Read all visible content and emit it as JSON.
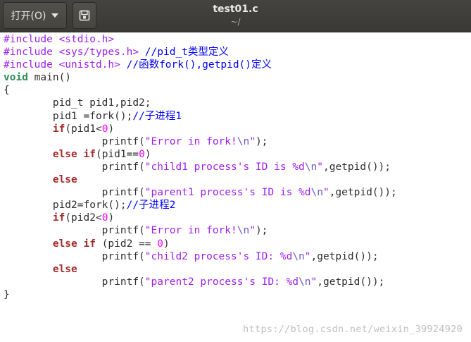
{
  "toolbar": {
    "open_label": "打开(O)",
    "title": "test01.c",
    "subtitle": "~/"
  },
  "editor": {
    "lines": [
      [
        {
          "t": "#include <stdio.h>",
          "c": "pp"
        }
      ],
      [
        {
          "t": "#include <sys/types.h>",
          "c": "pp"
        },
        {
          "t": " ",
          "c": ""
        },
        {
          "t": "//pid_t类型定义",
          "c": "cm"
        }
      ],
      [
        {
          "t": "#include <unistd.h>",
          "c": "pp"
        },
        {
          "t": " ",
          "c": ""
        },
        {
          "t": "//函数fork(),getpid()定义",
          "c": "cm"
        }
      ],
      [
        {
          "t": "void",
          "c": "ty"
        },
        {
          "t": " main()",
          "c": ""
        }
      ],
      [
        {
          "t": "{",
          "c": ""
        }
      ],
      [
        {
          "t": "        pid_t pid1,pid2;",
          "c": ""
        }
      ],
      [
        {
          "t": "        pid1 =fork();",
          "c": ""
        },
        {
          "t": "//子进程1",
          "c": "cm"
        }
      ],
      [
        {
          "t": "        ",
          "c": ""
        },
        {
          "t": "if",
          "c": "kw"
        },
        {
          "t": "(pid1<",
          "c": ""
        },
        {
          "t": "0",
          "c": "num"
        },
        {
          "t": ")",
          "c": ""
        }
      ],
      [
        {
          "t": "                printf(",
          "c": ""
        },
        {
          "t": "\"Error in fork!",
          "c": "str"
        },
        {
          "t": "\\n",
          "c": "esc"
        },
        {
          "t": "\"",
          "c": "str"
        },
        {
          "t": ");",
          "c": ""
        }
      ],
      [
        {
          "t": "        ",
          "c": ""
        },
        {
          "t": "else",
          "c": "kw"
        },
        {
          "t": " ",
          "c": ""
        },
        {
          "t": "if",
          "c": "kw"
        },
        {
          "t": "(pid1==",
          "c": ""
        },
        {
          "t": "0",
          "c": "num"
        },
        {
          "t": ")",
          "c": ""
        }
      ],
      [
        {
          "t": "                printf(",
          "c": ""
        },
        {
          "t": "\"child1 process's ID is %d",
          "c": "str"
        },
        {
          "t": "\\n",
          "c": "esc"
        },
        {
          "t": "\"",
          "c": "str"
        },
        {
          "t": ",getpid());",
          "c": ""
        }
      ],
      [
        {
          "t": "        ",
          "c": ""
        },
        {
          "t": "else",
          "c": "kw"
        }
      ],
      [
        {
          "t": "                printf(",
          "c": ""
        },
        {
          "t": "\"parent1 process's ID is %d",
          "c": "str"
        },
        {
          "t": "\\n",
          "c": "esc"
        },
        {
          "t": "\"",
          "c": "str"
        },
        {
          "t": ",getpid());",
          "c": ""
        }
      ],
      [
        {
          "t": "        pid2=fork();",
          "c": ""
        },
        {
          "t": "//子进程2",
          "c": "cm"
        }
      ],
      [
        {
          "t": "        ",
          "c": ""
        },
        {
          "t": "if",
          "c": "kw"
        },
        {
          "t": "(pid2<",
          "c": ""
        },
        {
          "t": "0",
          "c": "num"
        },
        {
          "t": ")",
          "c": ""
        }
      ],
      [
        {
          "t": "                printf(",
          "c": ""
        },
        {
          "t": "\"Error in fork!",
          "c": "str"
        },
        {
          "t": "\\n",
          "c": "esc"
        },
        {
          "t": "\"",
          "c": "str"
        },
        {
          "t": ");",
          "c": ""
        }
      ],
      [
        {
          "t": "        ",
          "c": ""
        },
        {
          "t": "else",
          "c": "kw"
        },
        {
          "t": " ",
          "c": ""
        },
        {
          "t": "if",
          "c": "kw"
        },
        {
          "t": " (pid2 == ",
          "c": ""
        },
        {
          "t": "0",
          "c": "num"
        },
        {
          "t": ")",
          "c": ""
        }
      ],
      [
        {
          "t": "                printf(",
          "c": ""
        },
        {
          "t": "\"child2 process's ID: %d",
          "c": "str"
        },
        {
          "t": "\\n",
          "c": "esc"
        },
        {
          "t": "\"",
          "c": "str"
        },
        {
          "t": ",getpid());",
          "c": ""
        }
      ],
      [
        {
          "t": "        ",
          "c": ""
        },
        {
          "t": "else",
          "c": "kw"
        }
      ],
      [
        {
          "t": "                printf(",
          "c": ""
        },
        {
          "t": "\"parent2 process's ID: %d",
          "c": "str"
        },
        {
          "t": "\\n",
          "c": "esc"
        },
        {
          "t": "\"",
          "c": "str"
        },
        {
          "t": ",getpid());",
          "c": ""
        }
      ],
      [
        {
          "t": "}",
          "c": ""
        }
      ]
    ]
  },
  "watermark": "https://blog.csdn.net/weixin_39924920",
  "colors": {
    "preprocessor": "#a020f0",
    "string": "#a020f0",
    "number": "#ff00ff",
    "keyword": "#a52a2a",
    "type": "#2e8b57",
    "comment": "#0000ff",
    "titlebar": "#3c3b37"
  },
  "icons": {
    "save": "save-document-icon",
    "dropdown": "chevron-down-icon"
  }
}
